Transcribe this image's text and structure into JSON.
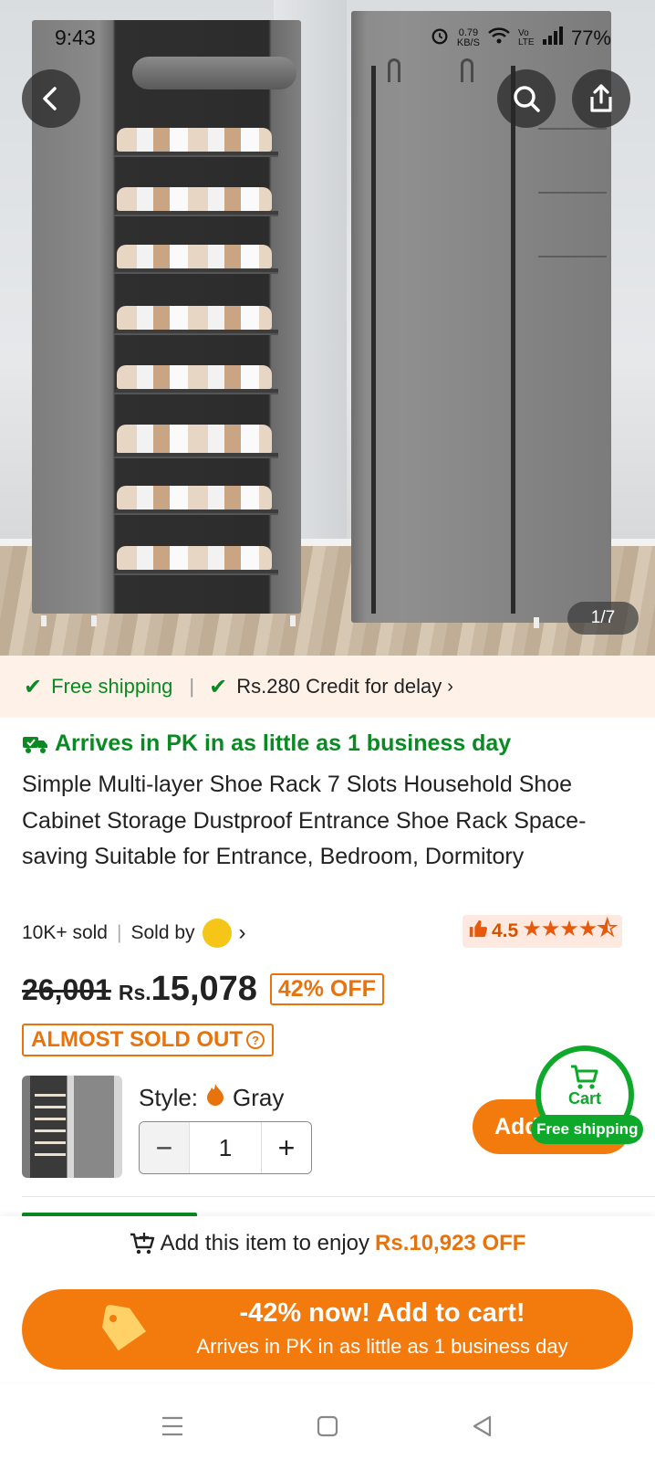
{
  "status_bar": {
    "time": "9:43",
    "net_speed_value": "0.79",
    "net_speed_unit": "KB/S",
    "network_tag": "Vo LTE",
    "battery": "77%"
  },
  "gallery": {
    "counter": "1/7"
  },
  "shipping_band": {
    "free_shipping": "Free shipping",
    "credit": "Rs.280 Credit for delay",
    "chevron": "›"
  },
  "product": {
    "arrival": "Arrives in PK in as little as 1 business day",
    "title": "Simple Multi-layer Shoe Rack 7 Slots Household Shoe Cabinet Storage Dustproof Entrance Shoe Rack Space-saving Suitable for Entrance, Bedroom, Dormitory",
    "sold_count": "10K+ sold",
    "sold_by": "Sold by",
    "seller_chevron": "›",
    "rating_value": "4.5",
    "rating_stars": "★★★★⯪",
    "rating_fraction": 0.9,
    "old_price": "26,001",
    "currency": "Rs.",
    "price": "15,078",
    "discount": "42% OFF",
    "stock_status": "ALMOST SOLD OUT",
    "stock_help": "?"
  },
  "options": {
    "style_label": "Style:",
    "style_value": "Gray",
    "qty_minus": "−",
    "qty_value": "1",
    "qty_plus": "+",
    "add_label": "Add to cart"
  },
  "cart_fab": {
    "label": "Cart",
    "pill": "Free shipping"
  },
  "bottom": {
    "enjoy_prefix": "Add this item to enjoy",
    "enjoy_amount": "Rs.10,923 OFF",
    "cta_main": "-42% now! Add to cart!",
    "cta_sub": "Arrives in PK in as little as 1 business day"
  },
  "colors": {
    "accent_orange": "#f37a0c",
    "green": "#0a8a22",
    "ship_band_bg": "#fdf1e8"
  },
  "icons": [
    "back-arrow-icon",
    "search-icon",
    "share-icon",
    "check-icon",
    "truck-icon",
    "thumbs-up-icon",
    "flame-icon",
    "cart-icon",
    "cart-plus-icon",
    "coupon-tag-icon",
    "menu-icon",
    "home-square-icon",
    "back-triangle-icon"
  ]
}
